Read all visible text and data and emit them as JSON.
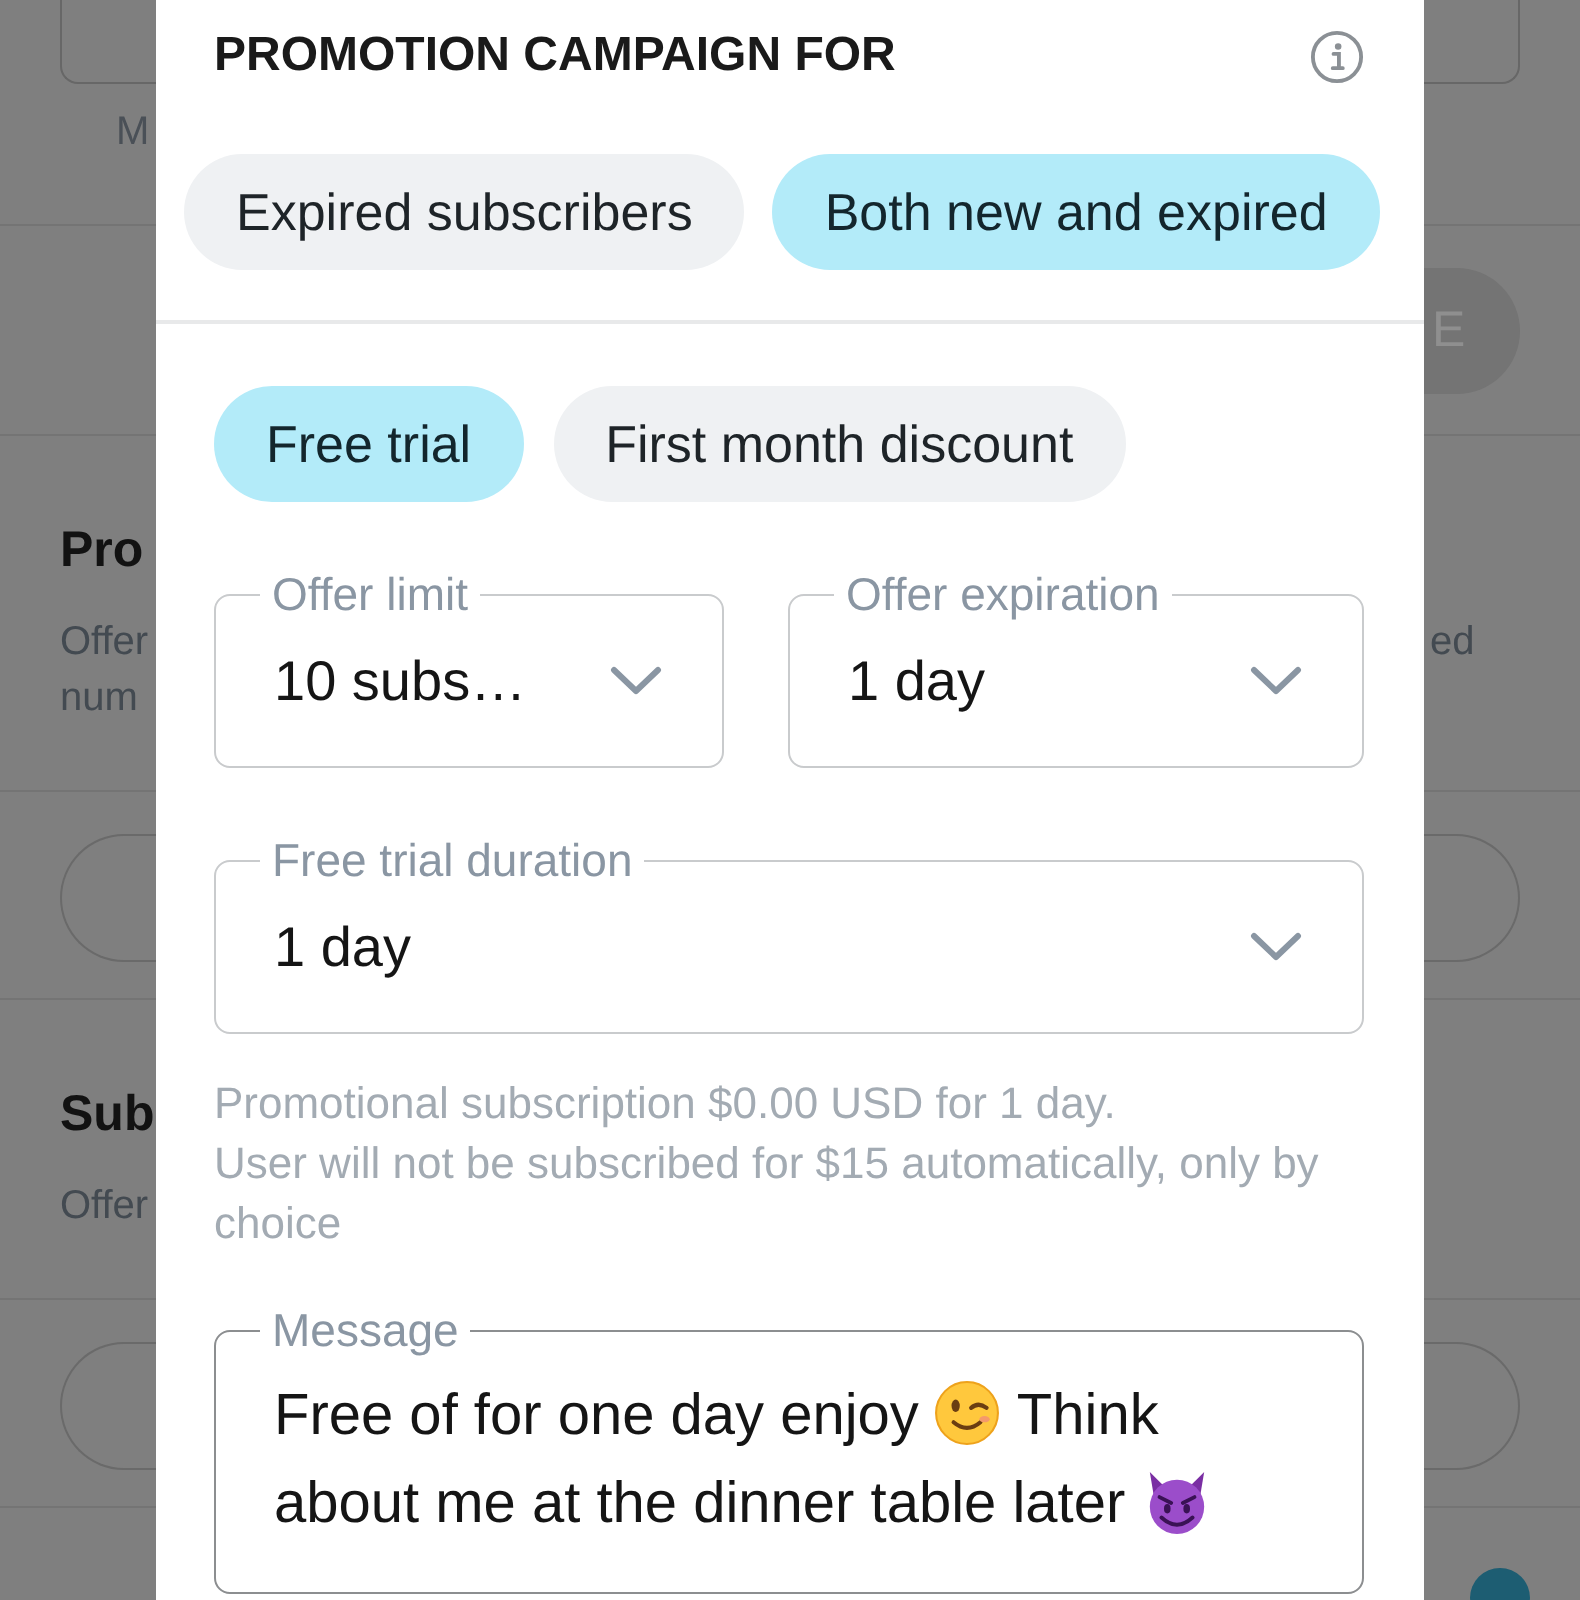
{
  "background": {
    "amount_hint": "M",
    "save_button": {
      "label": "E",
      "disabled": true
    },
    "sections": [
      {
        "title": "Pro",
        "description": [
          "Offer",
          "num"
        ],
        "description_end": "ed"
      },
      {
        "title": "Sub",
        "description": [
          "Offer"
        ]
      }
    ]
  },
  "dialog": {
    "title": "PROMOTION CAMPAIGN FOR",
    "audience": [
      {
        "label": "Expired subscribers",
        "selected": false
      },
      {
        "label": "Both new and expired",
        "selected": true
      }
    ],
    "offer_types": [
      {
        "label": "Free trial",
        "selected": true
      },
      {
        "label": "First month discount",
        "selected": false
      }
    ],
    "fields": [
      {
        "label": "Offer limit",
        "value": "10 subs…"
      },
      {
        "label": "Offer expiration",
        "value": "1 day"
      },
      {
        "label": "Free trial duration",
        "value": "1 day"
      }
    ],
    "hint": [
      "Promotional subscription $0.00 USD for 1 day.",
      "User will not be subscribed for $15 automatically, only by choice"
    ],
    "message": {
      "label": "Message",
      "focused": true,
      "value": [
        {
          "kind": "text",
          "text": "Free of for one day enjoy"
        },
        {
          "kind": "wink"
        },
        {
          "kind": "text",
          "text": "Think about me at the dinner table later"
        },
        {
          "kind": "devil"
        }
      ]
    }
  }
}
